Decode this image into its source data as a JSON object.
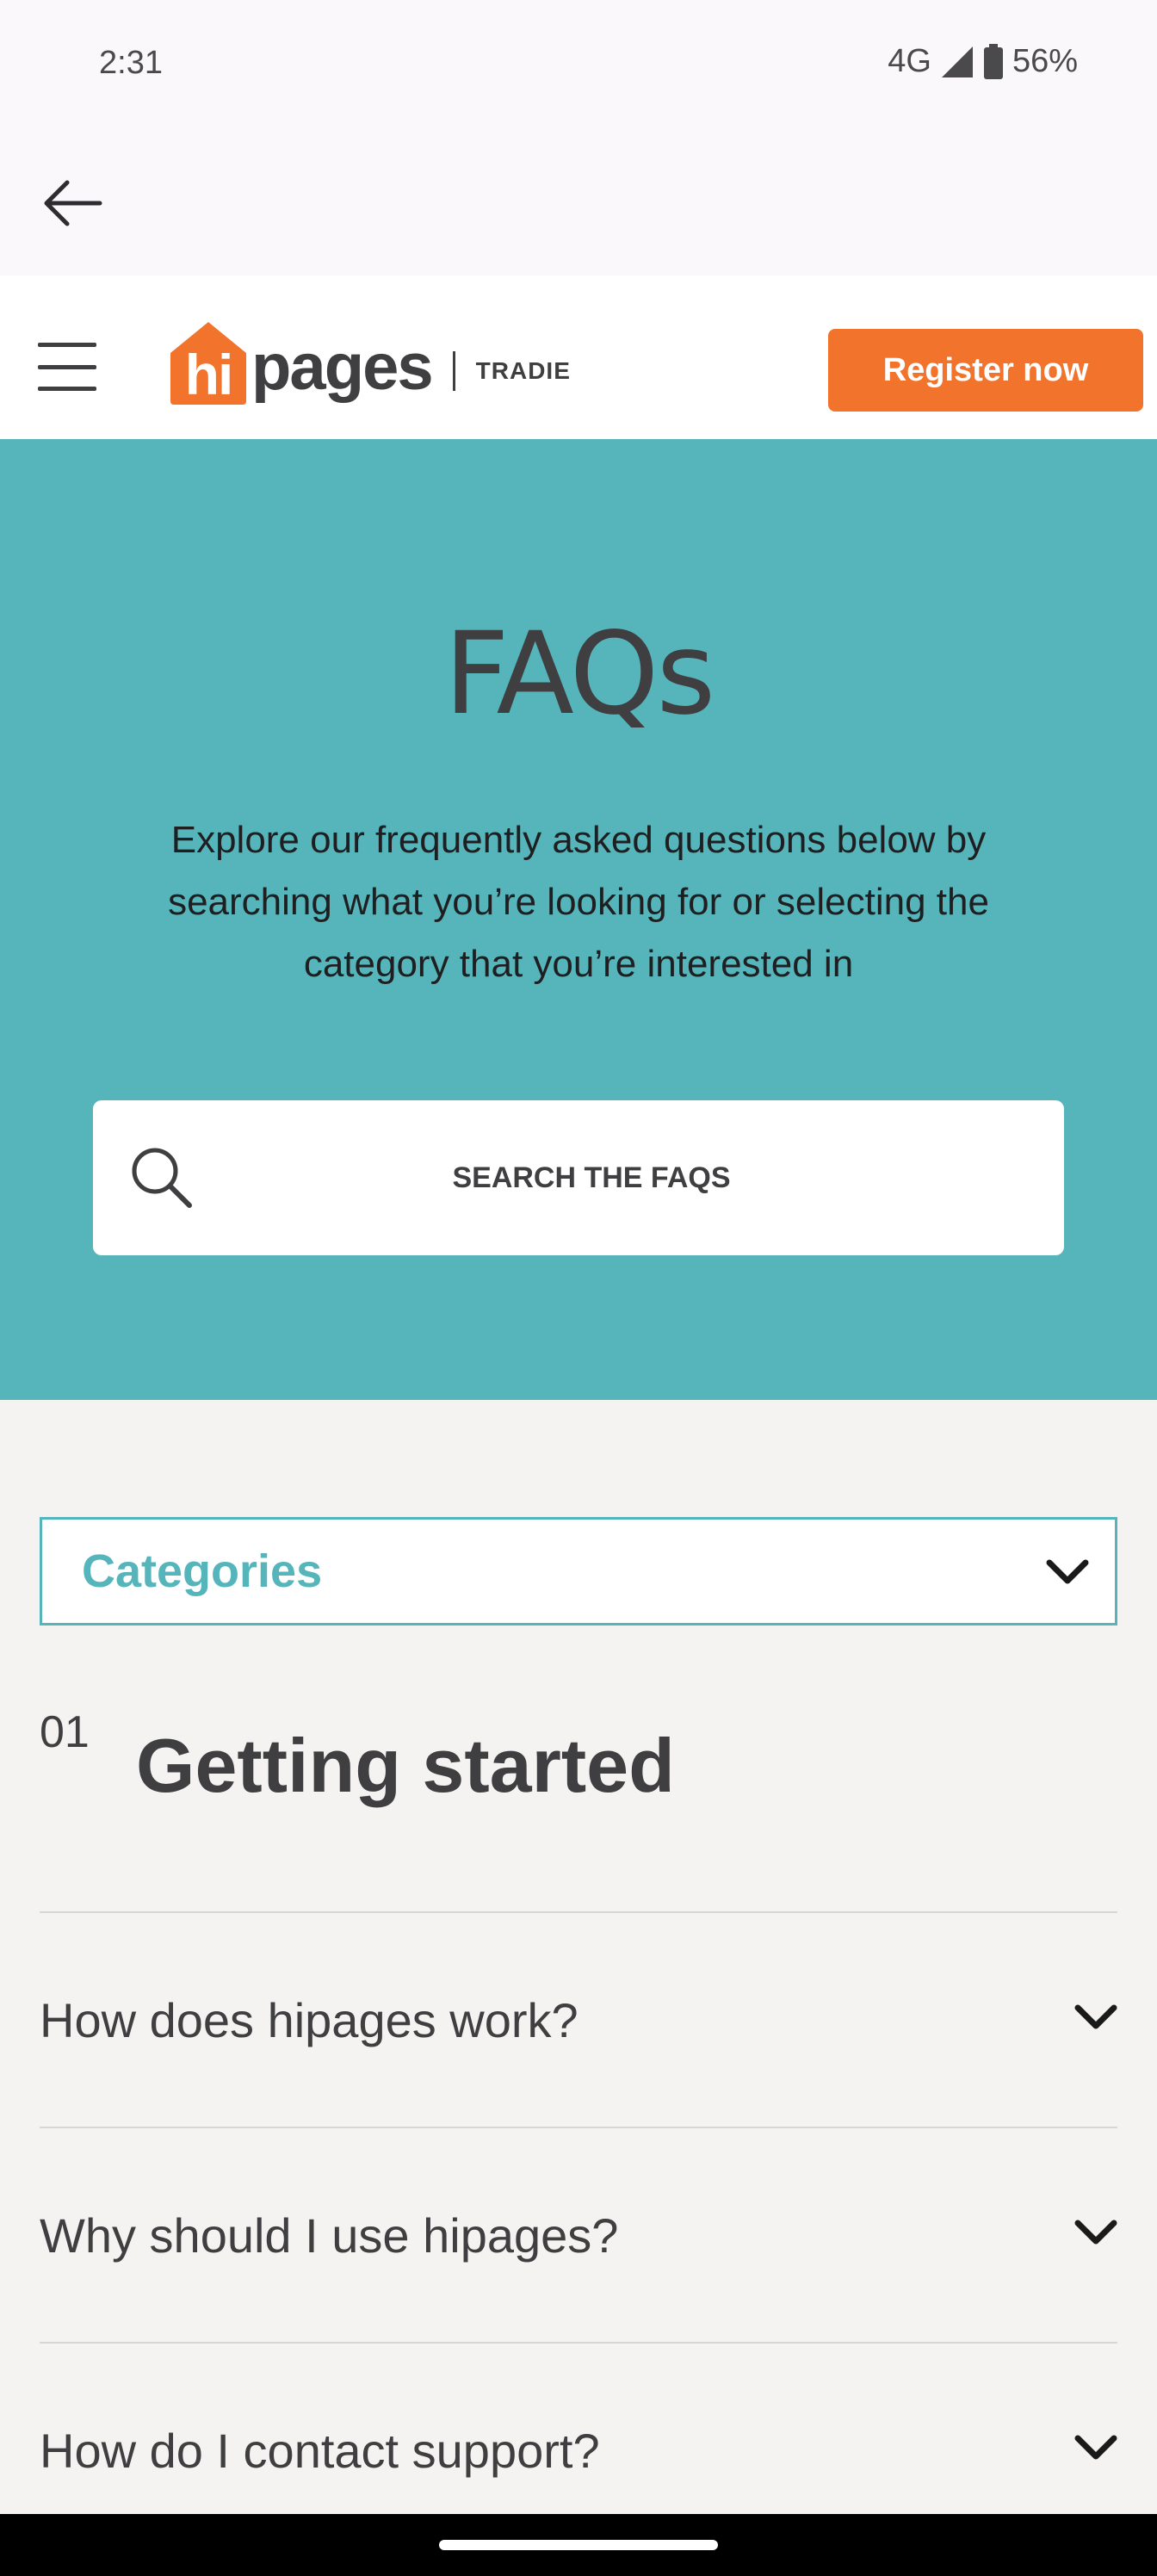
{
  "status_bar": {
    "time": "2:31",
    "network": "4G",
    "battery": "56%"
  },
  "header": {
    "logo_hi": "hi",
    "logo_pages": "pages",
    "logo_tradie": "TRADIE",
    "register_label": "Register now"
  },
  "hero": {
    "title": "FAQs",
    "description": "Explore our frequently asked questions below by searching what you’re looking for or selecting the category that you’re interested in",
    "search_label": "SEARCH THE FAQS"
  },
  "categories": {
    "label": "Categories"
  },
  "section": {
    "number": "01",
    "title": "Getting started",
    "questions": [
      "How does hipages work?",
      "Why should I use hipages?",
      "How do I contact support?"
    ]
  },
  "colors": {
    "brand_orange": "#f1732c",
    "teal": "#56b5ba",
    "text_dark": "#3f3f41"
  },
  "icons": [
    "back-arrow-icon",
    "signal-icon",
    "battery-icon",
    "hamburger-menu-icon",
    "search-icon",
    "chevron-down-icon"
  ]
}
